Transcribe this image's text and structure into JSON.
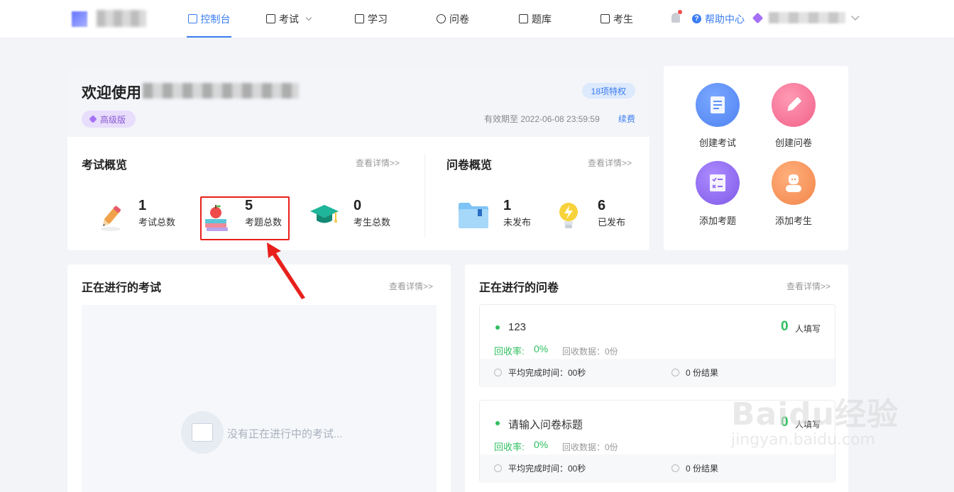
{
  "nav": {
    "items": [
      {
        "label": "控制台",
        "icon": "home-icon"
      },
      {
        "label": "考试",
        "icon": "calendar-icon"
      },
      {
        "label": "学习",
        "icon": "book-icon"
      },
      {
        "label": "问卷",
        "icon": "leaf-icon"
      },
      {
        "label": "题库",
        "icon": "database-icon"
      },
      {
        "label": "考生",
        "icon": "lock-user-icon"
      }
    ],
    "help_label": "帮助中心"
  },
  "welcome": {
    "title": "欢迎使用",
    "level_badge": "高级版",
    "privileges": "18项特权",
    "expiry": "有效期至 2022-06-08 23:59:59",
    "renew": "续费"
  },
  "exam_overview": {
    "title": "考试概览",
    "detail": "查看详情>>",
    "stats": [
      {
        "value": "1",
        "label": "考试总数"
      },
      {
        "value": "5",
        "label": "考题总数"
      },
      {
        "value": "0",
        "label": "考生总数"
      }
    ]
  },
  "survey_overview": {
    "title": "问卷概览",
    "detail": "查看详情>>",
    "stats": [
      {
        "value": "1",
        "label": "未发布"
      },
      {
        "value": "6",
        "label": "已发布"
      }
    ]
  },
  "quick_actions": [
    {
      "label": "创建考试",
      "icon": "document-icon",
      "color": "#5b8ff9"
    },
    {
      "label": "创建问卷",
      "icon": "pencil-icon",
      "color": "#f36d8e"
    },
    {
      "label": "添加考题",
      "icon": "checklist-icon",
      "color": "#8f6cf0"
    },
    {
      "label": "添加考生",
      "icon": "person-icon",
      "color": "#f5965a"
    }
  ],
  "ongoing_exams": {
    "title": "正在进行的考试",
    "detail": "查看详情>>",
    "empty_text": "没有正在进行中的考试..."
  },
  "ongoing_surveys": {
    "title": "正在进行的问卷",
    "detail": "查看详情>>",
    "items": [
      {
        "title": "123",
        "count": "0",
        "count_label": "人填写",
        "rate_label": "回收率:",
        "rate": "0%",
        "received": "回收数据：0份",
        "avg_time": "平均完成时间：00秒",
        "results": "0 份结果"
      },
      {
        "title": "请输入问卷标题",
        "count": "0",
        "count_label": "人填写",
        "rate_label": "回收率:",
        "rate": "0%",
        "received": "回收数据：0份",
        "avg_time": "平均完成时间：00秒",
        "results": "0 份结果"
      }
    ]
  },
  "watermark": {
    "main": "Baidu经验",
    "sub": "jingyan.baidu.com"
  },
  "colors": {
    "accent": "#3a7cf2",
    "success": "#2fbf5f",
    "highlight": "#e8201c"
  }
}
